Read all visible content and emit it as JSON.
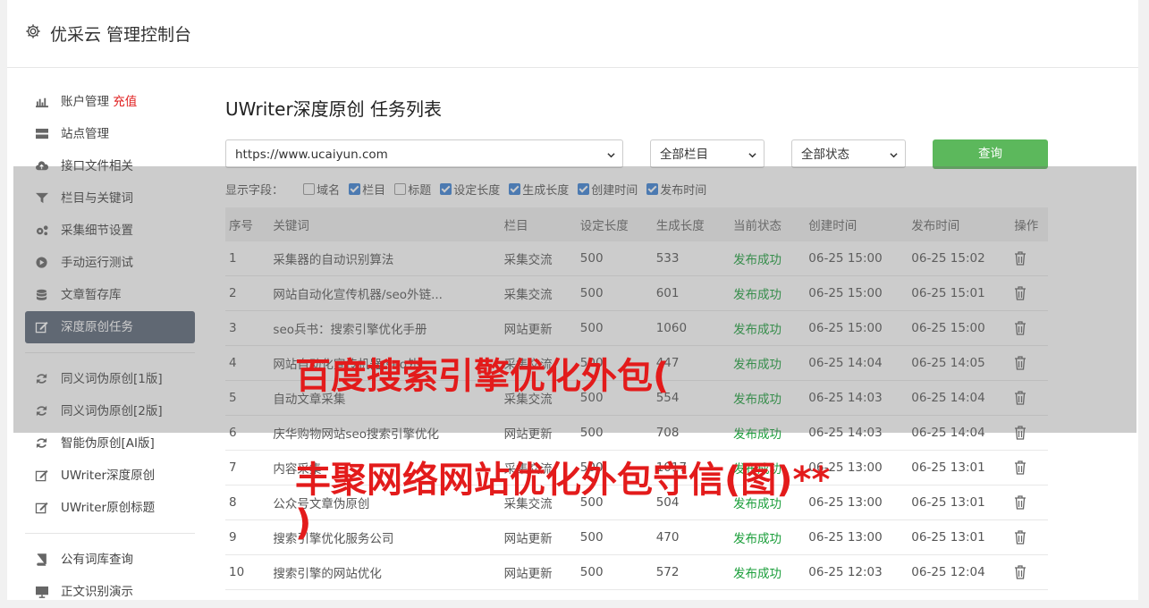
{
  "header": {
    "title": "优采云 管理控制台"
  },
  "sidebar": {
    "items": [
      {
        "label": "账户管理",
        "extra": "充值",
        "icon": "bar-chart-icon"
      },
      {
        "label": "站点管理",
        "icon": "server-icon"
      },
      {
        "label": "接口文件相关",
        "icon": "cloud-upload-icon"
      },
      {
        "label": "栏目与关键词",
        "icon": "filter-icon"
      },
      {
        "label": "采集细节设置",
        "icon": "gears-icon"
      },
      {
        "label": "手动运行测试",
        "icon": "play-circle-icon"
      },
      {
        "label": "文章暂存库",
        "icon": "database-icon"
      },
      {
        "label": "深度原创任务",
        "icon": "edit-icon",
        "active": true
      }
    ],
    "items2": [
      {
        "label": "同义词伪原创[1版]",
        "icon": "refresh-icon"
      },
      {
        "label": "同义词伪原创[2版]",
        "icon": "refresh-icon"
      },
      {
        "label": "智能伪原创[AI版]",
        "icon": "refresh-icon"
      },
      {
        "label": "UWriter深度原创",
        "icon": "edit-icon"
      },
      {
        "label": "UWriter原创标题",
        "icon": "edit-icon"
      }
    ],
    "items3": [
      {
        "label": "公有词库查询",
        "icon": "book-icon"
      },
      {
        "label": "正文识别演示",
        "icon": "monitor-icon"
      }
    ]
  },
  "main": {
    "title": "UWriter深度原创 任务列表",
    "site_select": "https://www.ucaiyun.com",
    "column_select": "全部栏目",
    "status_select": "全部状态",
    "query_label": "查询",
    "fields_label": "显示字段：",
    "fields": [
      {
        "label": "域名",
        "checked": false
      },
      {
        "label": "栏目",
        "checked": true
      },
      {
        "label": "标题",
        "checked": false
      },
      {
        "label": "设定长度",
        "checked": true
      },
      {
        "label": "生成长度",
        "checked": true
      },
      {
        "label": "创建时间",
        "checked": true
      },
      {
        "label": "发布时间",
        "checked": true
      }
    ],
    "columns": [
      "序号",
      "关键词",
      "栏目",
      "设定长度",
      "生成长度",
      "当前状态",
      "创建时间",
      "发布时间",
      "操作"
    ],
    "rows": [
      [
        "1",
        "采集器的自动识别算法",
        "采集交流",
        "500",
        "533",
        "发布成功",
        "06-25 15:00",
        "06-25 15:02"
      ],
      [
        "2",
        "网站自动化宣传机器/seo外链...",
        "采集交流",
        "500",
        "601",
        "发布成功",
        "06-25 15:00",
        "06-25 15:01"
      ],
      [
        "3",
        "seo兵书：搜索引擎优化手册",
        "网站更新",
        "500",
        "1060",
        "发布成功",
        "06-25 15:00",
        "06-25 15:00"
      ],
      [
        "4",
        "网站自动化宣传机器/seo外...",
        "采集交流",
        "500",
        "447",
        "发布成功",
        "06-25 14:04",
        "06-25 14:05"
      ],
      [
        "5",
        "自动文章采集",
        "采集交流",
        "500",
        "554",
        "发布成功",
        "06-25 14:03",
        "06-25 14:04"
      ],
      [
        "6",
        "庆华购物网站seo搜索引擎优化",
        "网站更新",
        "500",
        "708",
        "发布成功",
        "06-25 14:03",
        "06-25 14:04"
      ],
      [
        "7",
        "内容采集",
        "采集交流",
        "500",
        "1017",
        "发布成功",
        "06-25 13:00",
        "06-25 13:01"
      ],
      [
        "8",
        "公众号文章伪原创",
        "采集交流",
        "500",
        "504",
        "发布成功",
        "06-25 13:00",
        "06-25 13:01"
      ],
      [
        "9",
        "搜索引擎优化服务公司",
        "网站更新",
        "500",
        "470",
        "发布成功",
        "06-25 13:00",
        "06-25 13:01"
      ],
      [
        "10",
        "搜索引擎的网站优化",
        "网站更新",
        "500",
        "572",
        "发布成功",
        "06-25 12:03",
        "06-25 12:04"
      ]
    ]
  },
  "watermark": {
    "line1": "百度搜索引擎优化外包(",
    "line2": "丰聚网络网站优化外包守信(图)**",
    "line3": ")"
  },
  "colors": {
    "active_bg": "#5a6677",
    "accent_green": "#5cb85c",
    "status_green": "#1a9e3a",
    "watermark_red": "#e31b1b"
  }
}
